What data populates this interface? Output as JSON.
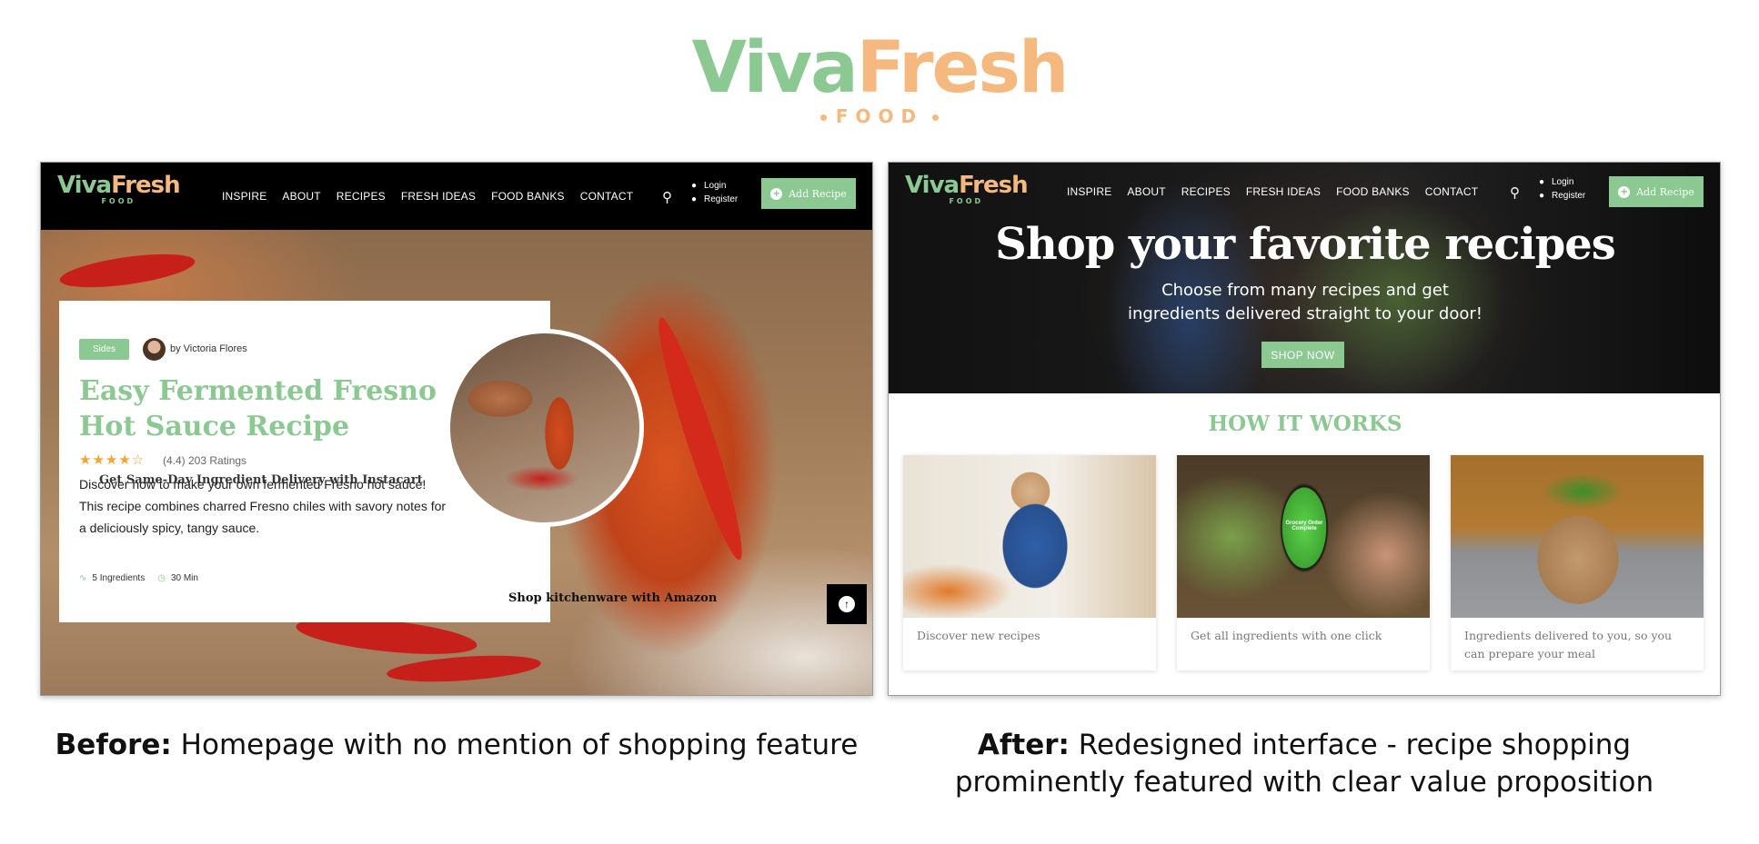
{
  "brand": {
    "viva": "Viva",
    "fresh": "Fresh",
    "food": "FOOD"
  },
  "nav": {
    "logo_viva": "Viva",
    "logo_fresh": "Fresh",
    "logo_food": "FOOD",
    "links": [
      "INSPIRE",
      "ABOUT",
      "RECIPES",
      "FRESH IDEAS",
      "FOOD BANKS",
      "CONTACT"
    ],
    "login": "Login",
    "register": "Register",
    "add_recipe": "Add Recipe"
  },
  "before": {
    "tag": "Sides",
    "author": "by Victoria Flores",
    "title": "Easy Fermented Fresno Hot Sauce Recipe",
    "stars": "★★★★☆",
    "rating": "(4.4) 203 Ratings",
    "overlap_text": "Get Same-Day Ingredient Delivery with Instacart",
    "description": "Discover how to make your own fermented Fresno hot sauce! This recipe combines charred Fresno chiles with savory notes for a deliciously spicy, tangy sauce.",
    "ingredients": "5 Ingredients",
    "time": "30 Min",
    "shop_kitchenware": "Shop kitchenware with Amazon",
    "caption_bold": "Before:",
    "caption": " Homepage with no mention of shopping feature"
  },
  "after": {
    "hero_title": "Shop your favorite recipes",
    "hero_sub_1": "Choose from many recipes and get",
    "hero_sub_2": "ingredients delivered straight to your door!",
    "shop_now": "SHOP NOW",
    "how_title": "HOW IT WORKS",
    "steps": [
      {
        "caption": "Discover new recipes"
      },
      {
        "caption": "Get all ingredients with one click"
      },
      {
        "caption": "Ingredients delivered to you, so you can prepare your meal"
      }
    ],
    "phone_text": "Grocery Order Complete",
    "caption_bold": "After:",
    "caption_1": " Redesigned interface - recipe shopping",
    "caption_2": "prominently featured with clear value proposition"
  },
  "colors": {
    "green": "#8cc992",
    "orange": "#f5b97f",
    "black": "#000000"
  }
}
